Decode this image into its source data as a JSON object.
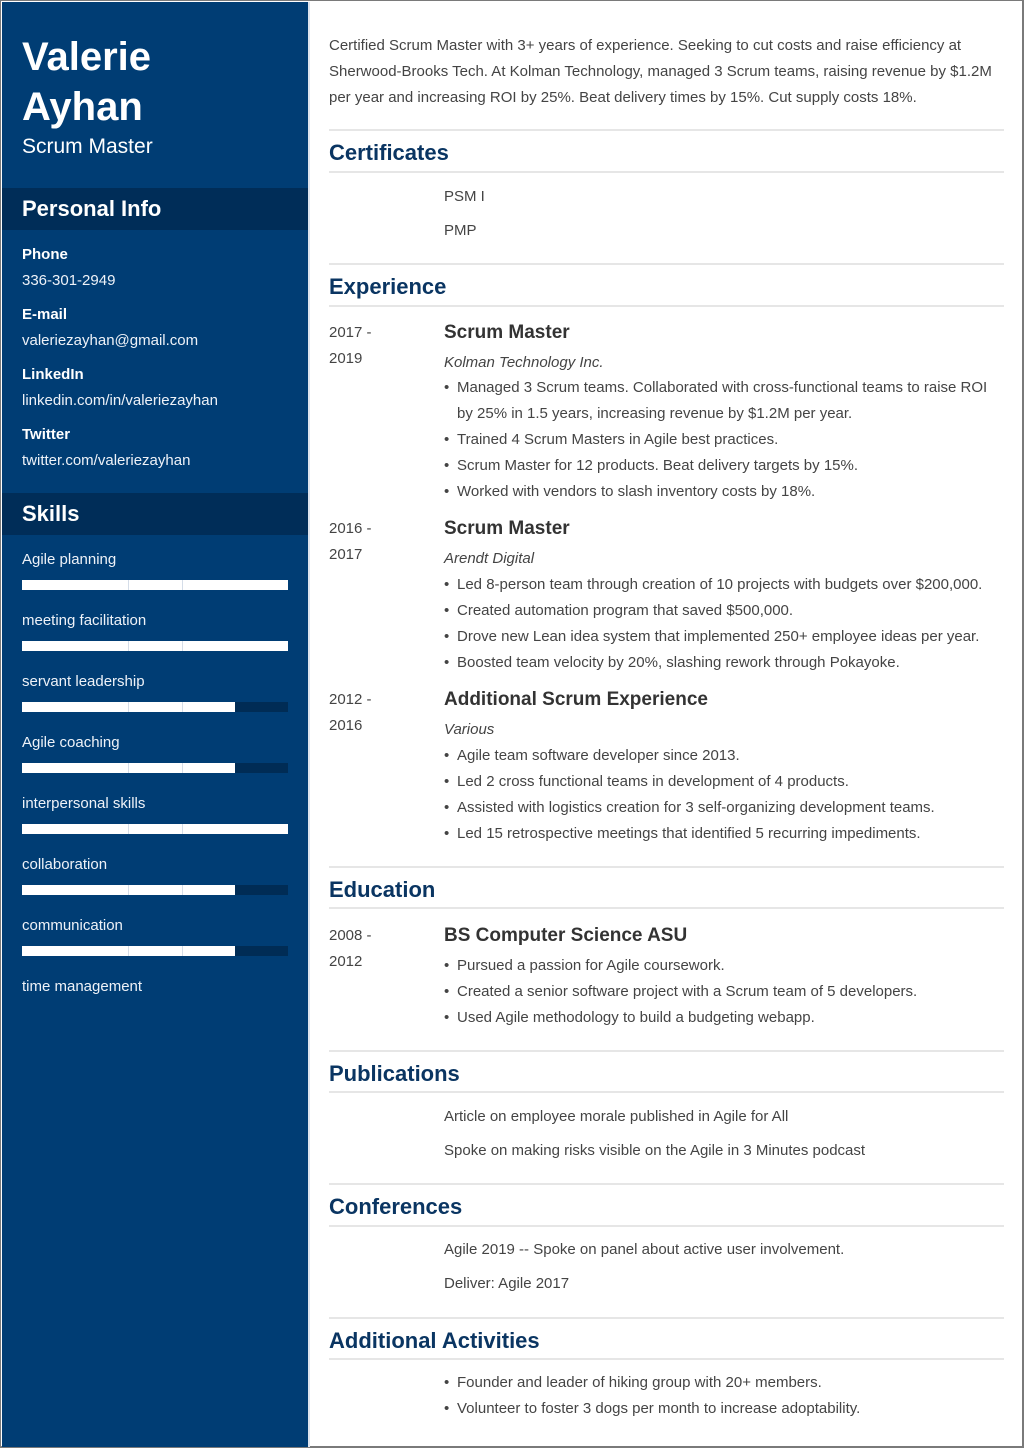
{
  "sidebar": {
    "name_first": "Valerie",
    "name_last": "Ayhan",
    "role": "Scrum Master",
    "personal_info_heading": "Personal Info",
    "personal_info": [
      {
        "label": "Phone",
        "value": "336-301-2949"
      },
      {
        "label": "E-mail",
        "value": "valeriezayhan@gmail.com"
      },
      {
        "label": "LinkedIn",
        "value": "linkedin.com/in/valeriezayhan"
      },
      {
        "label": "Twitter",
        "value": "twitter.com/valeriezayhan"
      }
    ],
    "skills_heading": "Skills",
    "skills": [
      {
        "name": "Agile planning",
        "level": 1.0
      },
      {
        "name": "meeting facilitation",
        "level": 1.0
      },
      {
        "name": "servant leadership",
        "level": 0.8
      },
      {
        "name": "Agile coaching",
        "level": 0.8
      },
      {
        "name": "interpersonal skills",
        "level": 1.0
      },
      {
        "name": "collaboration",
        "level": 0.8
      },
      {
        "name": "communication",
        "level": 0.8
      },
      {
        "name": "time management",
        "level": null
      }
    ]
  },
  "colors": {
    "sidebar_bg": "#003d74",
    "sidebar_heading_bg": "#002d58",
    "section_title": "#0a3562",
    "body_text": "#444444"
  },
  "main": {
    "summary": "Certified Scrum Master with 3+ years of experience. Seeking to cut costs and raise efficiency at Sherwood-Brooks Tech. At Kolman Technology, managed 3 Scrum teams, raising revenue by $1.2M per year and increasing ROI by 25%. Beat delivery times by 15%. Cut supply costs 18%.",
    "certificates": {
      "title": "Certificates",
      "items": [
        "PSM I",
        "PMP"
      ]
    },
    "experience": {
      "title": "Experience",
      "jobs": [
        {
          "date_start": "2017 -",
          "date_end": "2019",
          "title": "Scrum Master",
          "company": "Kolman Technology Inc.",
          "bullets": [
            "Managed 3 Scrum teams. Collaborated with cross-functional teams to raise ROI by 25% in 1.5 years, increasing revenue by $1.2M per year.",
            "Trained 4 Scrum Masters in Agile best practices.",
            "Scrum Master for 12 products. Beat delivery targets by 15%.",
            "Worked with vendors to slash inventory costs by 18%."
          ]
        },
        {
          "date_start": "2016 -",
          "date_end": "2017",
          "title": "Scrum Master",
          "company": "Arendt Digital",
          "bullets": [
            "Led 8-person team through creation of 10 projects with budgets over $200,000.",
            "Created automation program that saved $500,000.",
            "Drove new Lean idea system that implemented 250+ employee ideas per year.",
            "Boosted team velocity by 20%, slashing rework through Pokayoke."
          ]
        },
        {
          "date_start": "2012 -",
          "date_end": "2016",
          "title": "Additional Scrum Experience",
          "company": "Various",
          "bullets": [
            "Agile team software developer since 2013.",
            "Led 2 cross functional teams in development of 4 products.",
            "Assisted with logistics creation for 3 self-organizing development teams.",
            "Led 15 retrospective meetings that identified 5 recurring impediments."
          ]
        }
      ]
    },
    "education": {
      "title": "Education",
      "date_start": "2008 -",
      "date_end": "2012",
      "degree": "BS Computer Science ASU",
      "bullets": [
        "Pursued a passion for Agile coursework.",
        "Created a senior software project with a Scrum team of 5 developers.",
        "Used Agile methodology to build a budgeting webapp."
      ]
    },
    "publications": {
      "title": "Publications",
      "items": [
        "Article on employee morale published in Agile for All",
        "Spoke on making risks visible on the Agile in 3 Minutes podcast"
      ]
    },
    "conferences": {
      "title": "Conferences",
      "items": [
        "Agile 2019 -- Spoke on panel about active user involvement.",
        "Deliver: Agile 2017"
      ]
    },
    "activities": {
      "title": "Additional Activities",
      "bullets": [
        "Founder and leader of hiking group with 20+ members.",
        "Volunteer to foster 3 dogs per month to increase adoptability."
      ]
    }
  }
}
